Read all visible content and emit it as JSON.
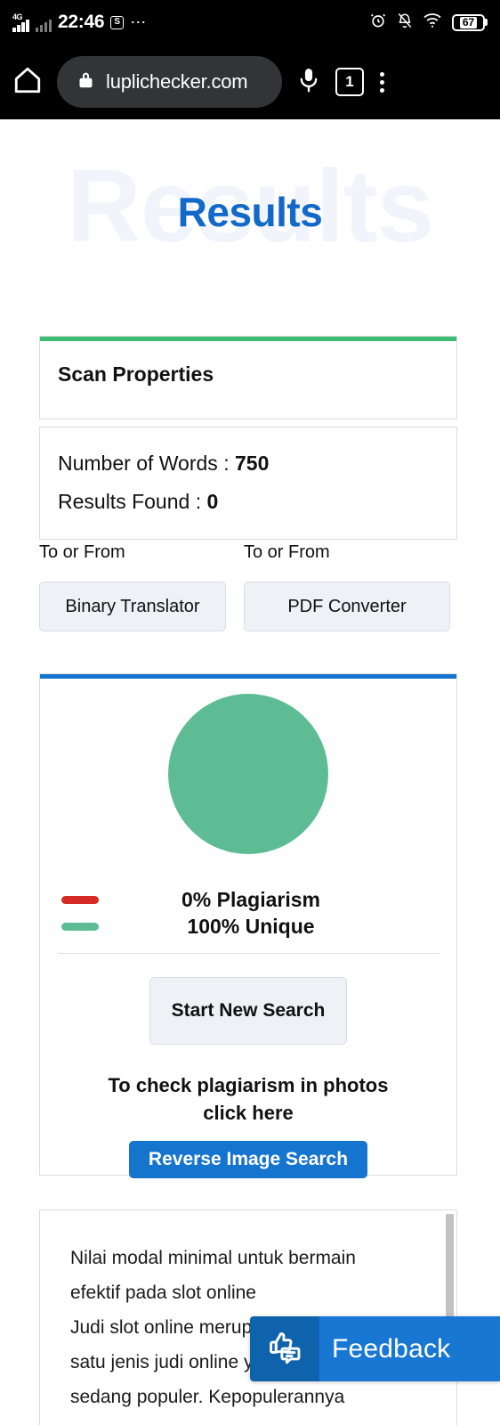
{
  "status_bar": {
    "network_label": "4G",
    "time": "22:46",
    "screenshot_icon": "screenshot-icon",
    "overflow_icon": "more-dots-icon",
    "alarm_icon": "alarm-clock-icon",
    "bell_muted_icon": "bell-muted-icon",
    "wifi_icon": "wifi-icon",
    "battery_level": "67"
  },
  "browser": {
    "home_icon": "home-icon",
    "lock_icon": "lock-icon",
    "url": "luplichecker.com",
    "mic_icon": "microphone-icon",
    "tab_count": "1",
    "menu_icon": "kebab-menu-icon"
  },
  "hero": {
    "ghost_text": "Results",
    "title": "Results",
    "title_color": "#1269c9"
  },
  "scan_properties": {
    "accent_color": "#3cbd72",
    "title": "Scan Properties"
  },
  "stats": {
    "words_label": "Number of Words : ",
    "words_value": "750",
    "results_label": "Results Found : ",
    "results_value": "0"
  },
  "tools": [
    {
      "label": "To or From",
      "button": "Binary Translator"
    },
    {
      "label": "To or From",
      "button": "PDF Converter"
    }
  ],
  "chart_card": {
    "accent_color": "#1574cd",
    "start_new_search": "Start New Search",
    "photo_note_line1": "To check plagiarism in photos",
    "photo_note_line2": "click here",
    "reverse_image_search": "Reverse Image Search"
  },
  "chart_data": {
    "type": "pie",
    "title": "",
    "categories": [
      "Plagiarism",
      "Unique"
    ],
    "values": [
      0,
      100
    ],
    "colors": [
      "#d62a26",
      "#5dbc94"
    ],
    "legend": [
      "0% Plagiarism",
      "100% Unique"
    ],
    "legend_position": "bottom",
    "donut": true,
    "inner_radius_ratio": 0.667
  },
  "text_panel": {
    "lines": [
      "Nilai modal minimal untuk bermain",
      "efektif pada slot online",
      "Judi slot online merupakan salah",
      "satu jenis judi online yang",
      "sedang populer. Kepopulerannya"
    ]
  },
  "feedback": {
    "icon": "thumbs-up-feedback-icon",
    "label": "Feedback",
    "icon_bg": "#0f62ac",
    "label_bg": "#1877d2"
  }
}
